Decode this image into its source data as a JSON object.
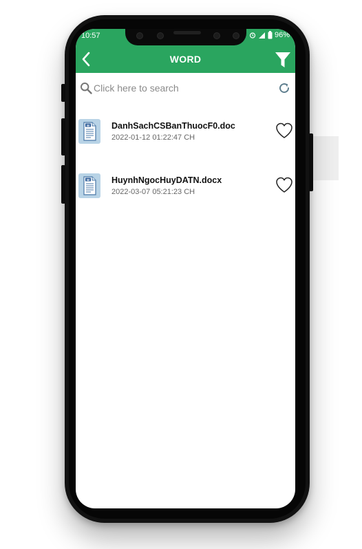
{
  "status_bar": {
    "time": "10:57",
    "battery": "96%"
  },
  "appbar": {
    "title": "WORD",
    "back_icon": "chevron-left-icon",
    "filter_icon": "funnel-icon",
    "color": "#2aa55f"
  },
  "search": {
    "placeholder": "Click here to search",
    "value": "",
    "refresh_icon": "refresh-icon"
  },
  "files": [
    {
      "name": "DanhSachCSBanThuocF0.doc",
      "date": "2022-01-12 01:22:47 CH",
      "icon": "word-document-icon",
      "favorite": false
    },
    {
      "name": "HuynhNgocHuyDATN.docx",
      "date": "2022-03-07 05:21:23 CH",
      "icon": "word-document-icon",
      "favorite": false
    }
  ]
}
